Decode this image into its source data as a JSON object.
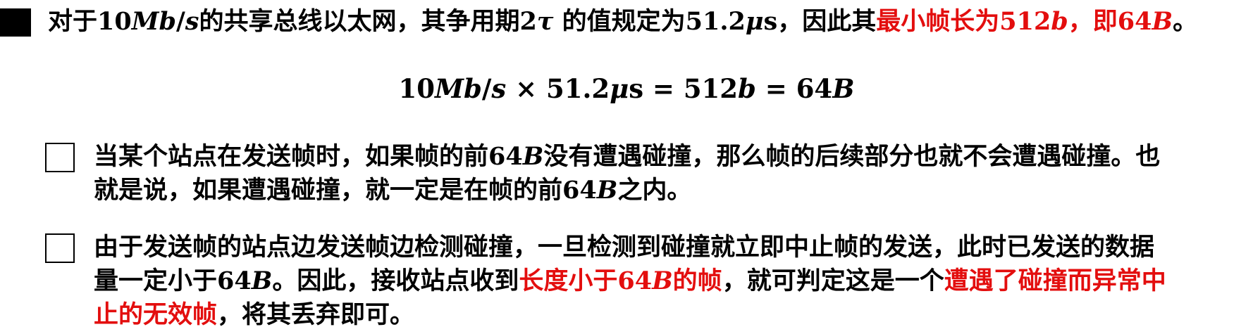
{
  "heading": {
    "t1": "对于",
    "speed_num": "10",
    "speed_unit": "Mb",
    "speed_slash": "/",
    "speed_s": "s",
    "t2": "的共享总线以太网，其争用期",
    "tau_num": "2",
    "tau": "τ",
    "t3": "的值规定为",
    "period_num": "51.2",
    "period_mu": "μ",
    "period_s": "s",
    "t4": "，因此其",
    "red1": "最小帧长为",
    "red_bits_num": "512",
    "red_bits_unit": "b",
    "red2": "，即",
    "red_bytes_num": "64",
    "red_bytes_unit": "B",
    "t5": "。"
  },
  "formula": {
    "a_num": "10",
    "a_unit": "Mb",
    "a_slash": "/",
    "a_s": "s",
    "times": " × ",
    "b_num": "51.2",
    "b_mu": "μ",
    "b_s": "s",
    "eq1": " = ",
    "c_num": "512",
    "c_unit": "b",
    "eq2": " = ",
    "d_num": "64",
    "d_unit": "B"
  },
  "point1": {
    "l1a": "当某个站点在发送帧时，如果帧的前",
    "l1_num": "64",
    "l1_unit": "B",
    "l1b": "没有遭遇碰撞，那么帧的后续部分也就不会遭遇碰撞。也",
    "l2a": "就是说，如果遭遇碰撞，就一定是在帧的前",
    "l2_num": "64",
    "l2_unit": "B",
    "l2b": "之内。"
  },
  "point2": {
    "l1": "由于发送帧的站点边发送帧边检测碰撞，一旦检测到碰撞就立即中止帧的发送，此时已发送的数据",
    "l2a": "量一定小于",
    "l2_num": "64",
    "l2_unit": "B",
    "l2b": "。因此，接收站点收到",
    "l2_red_a": "长度小于",
    "l2_red_num": "64",
    "l2_red_unit": "B",
    "l2_red_b": "的帧",
    "l2c": "，就可判定这是一个",
    "l2_red2": "遭遇了碰撞而异常中",
    "l3_red": "止的无效帧",
    "l3": "，将其丢弃即可。"
  },
  "colors": {
    "emphasis_red": "#e30e0e",
    "text": "#000000",
    "background": "#ffffff"
  },
  "icons": [
    "square-bullet-icon",
    "checkbox-icon"
  ]
}
